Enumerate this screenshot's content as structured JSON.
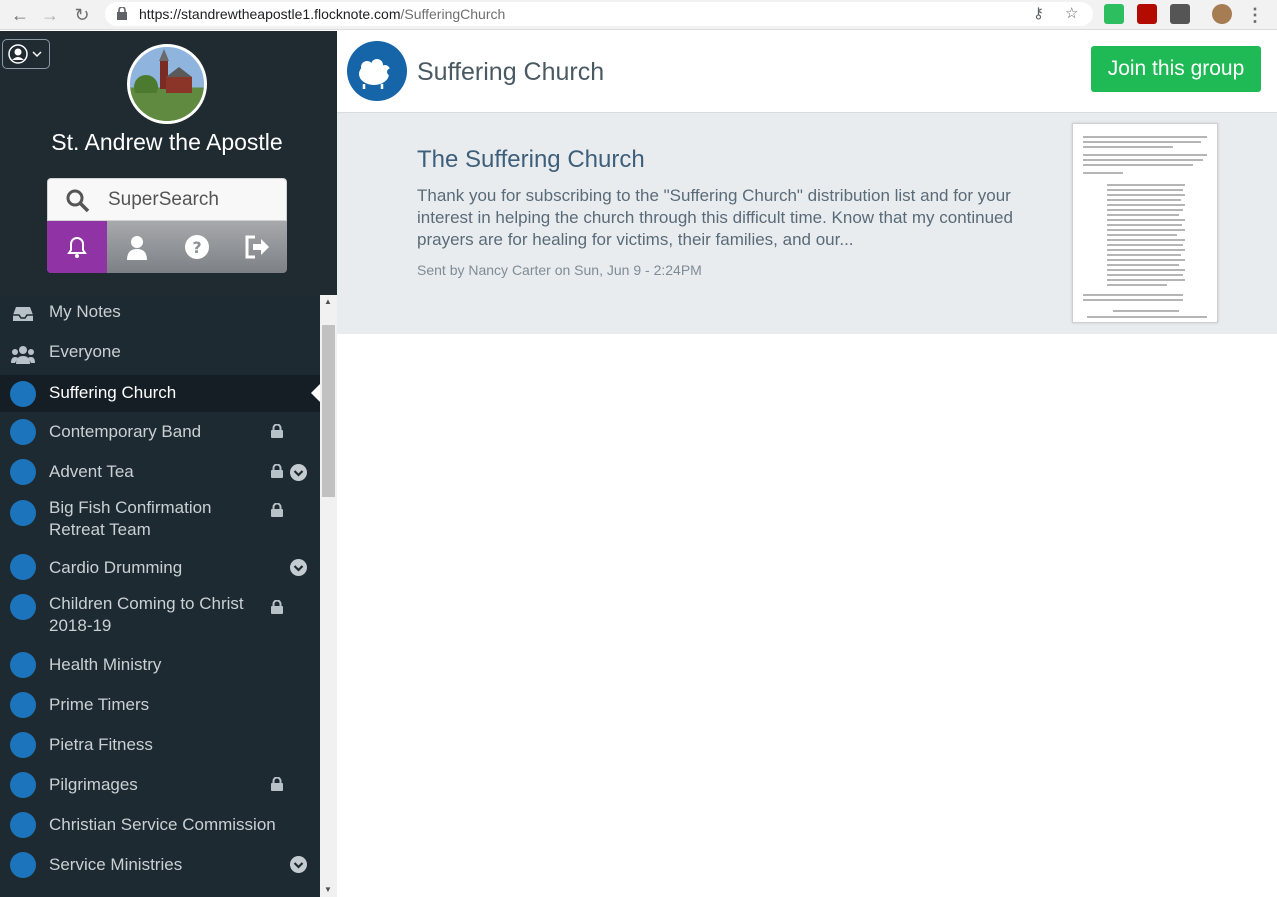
{
  "browser": {
    "url_host": "https://standrewtheapostle1.flocknote.com",
    "url_path": "/SufferingChurch"
  },
  "org": {
    "name": "St. Andrew the Apostle"
  },
  "search": {
    "placeholder": "SuperSearch"
  },
  "nav": {
    "items": [
      {
        "label": "My Notes",
        "icon": "inbox-icon"
      },
      {
        "label": "Everyone",
        "icon": "people-icon"
      },
      {
        "label": "Suffering Church",
        "icon": "group-icon",
        "active": true
      },
      {
        "label": "Contemporary Band",
        "locked": true
      },
      {
        "label": "Advent Tea",
        "locked": true,
        "expandable": true
      },
      {
        "label": "Big Fish Confirmation Retreat Team",
        "locked": true
      },
      {
        "label": "Cardio Drumming",
        "expandable": true
      },
      {
        "label": "Children Coming to Christ 2018-19",
        "locked": true
      },
      {
        "label": "Health Ministry"
      },
      {
        "label": "Prime Timers"
      },
      {
        "label": "Pietra Fitness"
      },
      {
        "label": "Pilgrimages",
        "locked": true
      },
      {
        "label": "Christian Service Commission"
      },
      {
        "label": "Service Ministries",
        "expandable": true
      }
    ]
  },
  "group": {
    "title": "Suffering Church",
    "join_label": "Join this group"
  },
  "note": {
    "title": "The Suffering Church",
    "body": "Thank you for subscribing to the \"Suffering Church\" distribution list and for your interest in helping the church through this difficult time.  Know that my continued prayers are for healing for victims, their families, and our...",
    "meta": "Sent by Nancy Carter on Sun, Jun 9 - 2:24PM"
  },
  "colors": {
    "accent_purple": "#8f33a5",
    "join_green": "#1fba55",
    "sidebar_bg": "#1e2a32",
    "brand_blue": "#1c75bc"
  }
}
